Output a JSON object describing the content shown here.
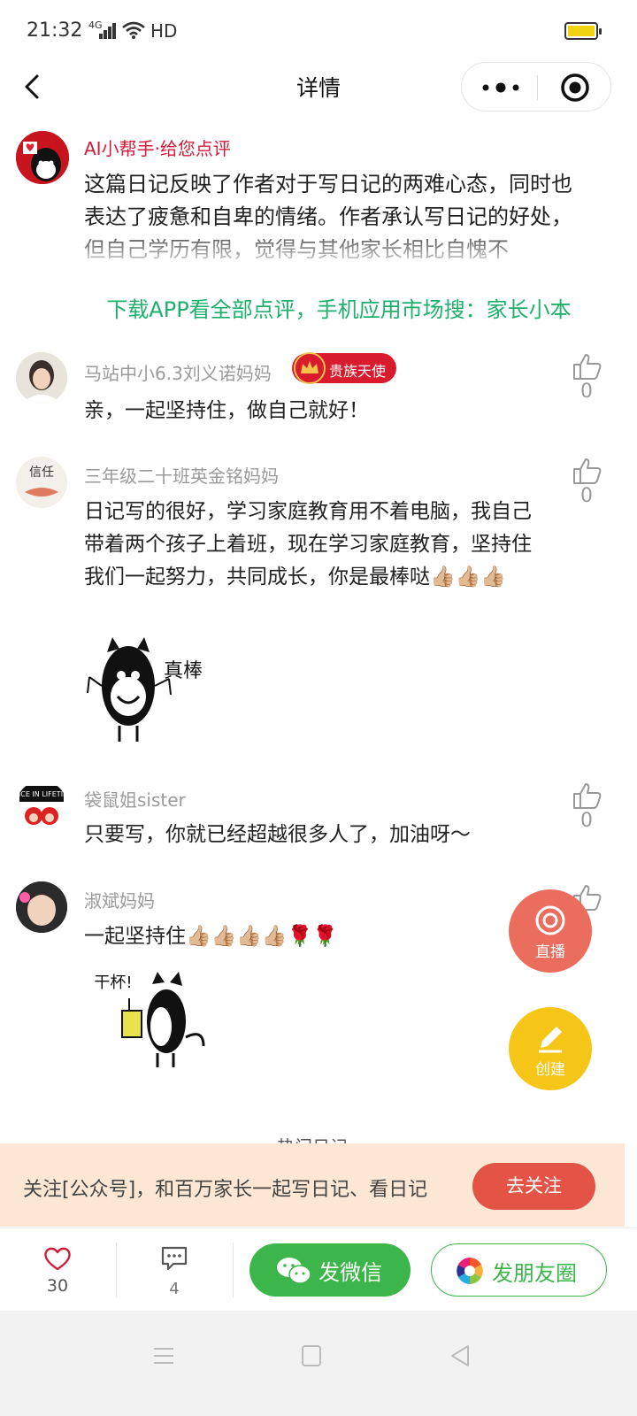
{
  "status_bar": {
    "time": "21:32",
    "signal": "4G",
    "network": "HD"
  },
  "nav": {
    "title": "详情"
  },
  "ai_review": {
    "name": "AI小帮手·给您点评",
    "text": "这篇日记反映了作者对于写日记的两难心态，同时也表达了疲惫和自卑的情绪。作者承认写日记的好处，但自己学历有限，觉得与其他家长相比自愧不",
    "download_prompt": "下载APP看全部点评，手机应用市场搜：家长小本"
  },
  "comments": [
    {
      "name": "马站中小6.3刘义诺妈妈",
      "badge": "贵族天使",
      "text": "亲，一起坚持住，做自己就好！",
      "likes": "0"
    },
    {
      "name": "三年级二十班英金铭妈妈",
      "text": "日记写的很好，学习家庭教育用不着电脑，我自己带着两个孩子上着班，现在学习家庭教育，坚持住我们一起努力，共同成长，你是最棒哒👍🏼👍🏼👍🏼",
      "likes": "0",
      "sticker_text": "真棒"
    },
    {
      "name": "袋鼠姐sister",
      "text": "只要写，你就已经超越很多人了，加油呀～",
      "likes": "0",
      "avatar_text": "ONCE IN LIFETIME"
    },
    {
      "name": "淑斌妈妈",
      "text": "一起坚持住👍🏼👍🏼👍🏼👍🏼🌹🌹",
      "sticker_text": "干杯!"
    }
  ],
  "fab": {
    "live_label": "直播",
    "create_label": "创建"
  },
  "hot_label": "热门日记",
  "follow_banner": {
    "text": "关注[公众号]，和百万家长一起写日记、看日记",
    "button": "去关注"
  },
  "bottom_bar": {
    "like_count": "30",
    "comment_count": "4",
    "wechat_label": "发微信",
    "moments_label": "发朋友圈"
  },
  "colors": {
    "green": "#3cb54a",
    "red": "#e35446",
    "ai_red": "#d01c3a",
    "download_green": "#1fb06b",
    "banner_bg": "#fbe7d3",
    "fab_live": "#ea6d5d",
    "fab_create": "#f5c518"
  }
}
